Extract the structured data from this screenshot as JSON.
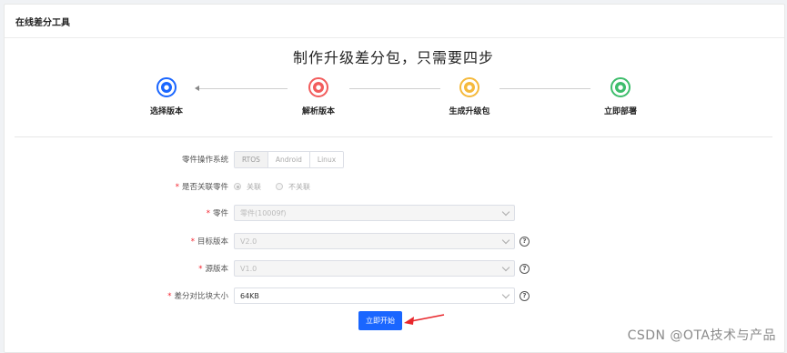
{
  "card": {
    "title": "在线差分工具"
  },
  "headline": "制作升级差分包，只需要四步",
  "steps": [
    {
      "label": "选择版本",
      "color": "#1a66ff",
      "icon": "hand-pointer-icon"
    },
    {
      "label": "解析版本",
      "color": "#f25c5c",
      "icon": "cloud-icon"
    },
    {
      "label": "生成升级包",
      "color": "#f5b93b",
      "icon": "tag-icon"
    },
    {
      "label": "立即部署",
      "color": "#3dbd6b",
      "icon": "deploy-icon"
    }
  ],
  "form": {
    "os": {
      "label": "零件操作系统",
      "options": [
        "RTOS",
        "Android",
        "Linux"
      ],
      "selected": "RTOS"
    },
    "link_part": {
      "label": "是否关联零件",
      "options": [
        "关联",
        "不关联"
      ],
      "selected": "关联"
    },
    "part": {
      "label": "零件",
      "value": "零件(10009f)"
    },
    "target_version": {
      "label": "目标版本",
      "value": "V2.0"
    },
    "source_version": {
      "label": "源版本",
      "value": "V1.0"
    },
    "block_size": {
      "label": "差分对比块大小",
      "value": "64KB"
    },
    "help_symbol": "?",
    "required_mark": "*"
  },
  "submit": {
    "label": "立即开始"
  },
  "watermark": "CSDN @OTA技术与产品"
}
